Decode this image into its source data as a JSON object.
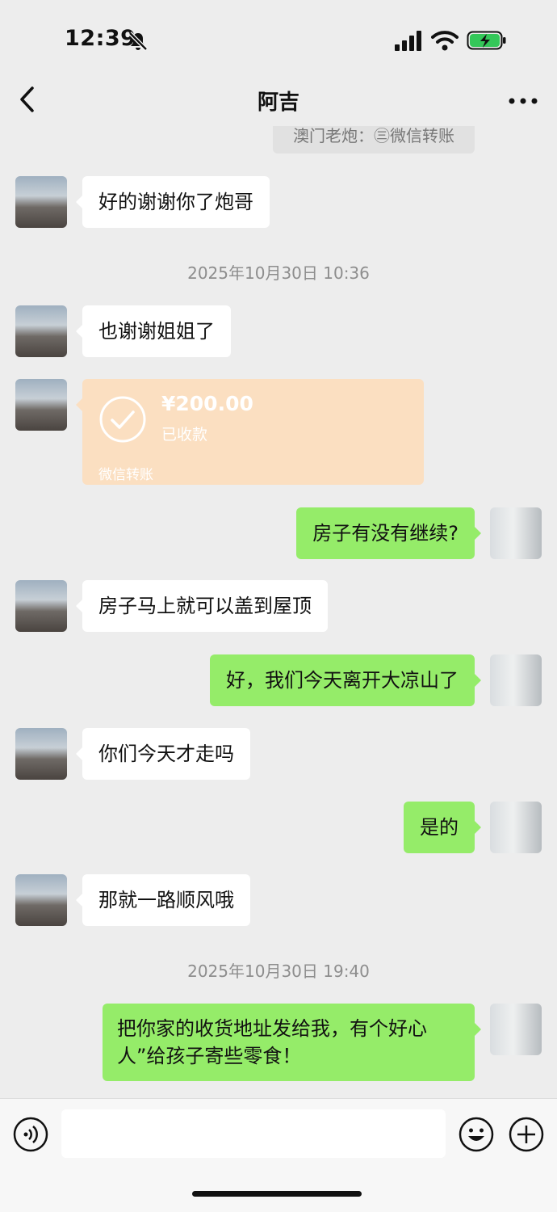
{
  "status": {
    "time": "12:39"
  },
  "header": {
    "title": "阿吉"
  },
  "system_notice": "澳门老炮：㊂微信转账",
  "messages": {
    "m1": "好的谢谢你了炮哥",
    "ts1": "2025年10月30日 10:36",
    "m2": "也谢谢姐姐了",
    "transfer": {
      "amount": "¥200.00",
      "status": "已收款",
      "label": "微信转账"
    },
    "m3": "房子有没有继续?",
    "m4": "房子马上就可以盖到屋顶",
    "m5": "好，我们今天离开大凉山了",
    "m6": "你们今天才走吗",
    "m7": "是的",
    "m8": "那就一路顺风哦",
    "ts2": "2025年10月30日 19:40",
    "m9": "把你家的收货地址发给我，有个好心人”给孩子寄些零食！"
  },
  "input": {
    "value": ""
  },
  "colors": {
    "self_bubble": "#95ec69",
    "other_bubble": "#ffffff",
    "transfer_bubble": "#fbdfc1",
    "background": "#ededed"
  }
}
